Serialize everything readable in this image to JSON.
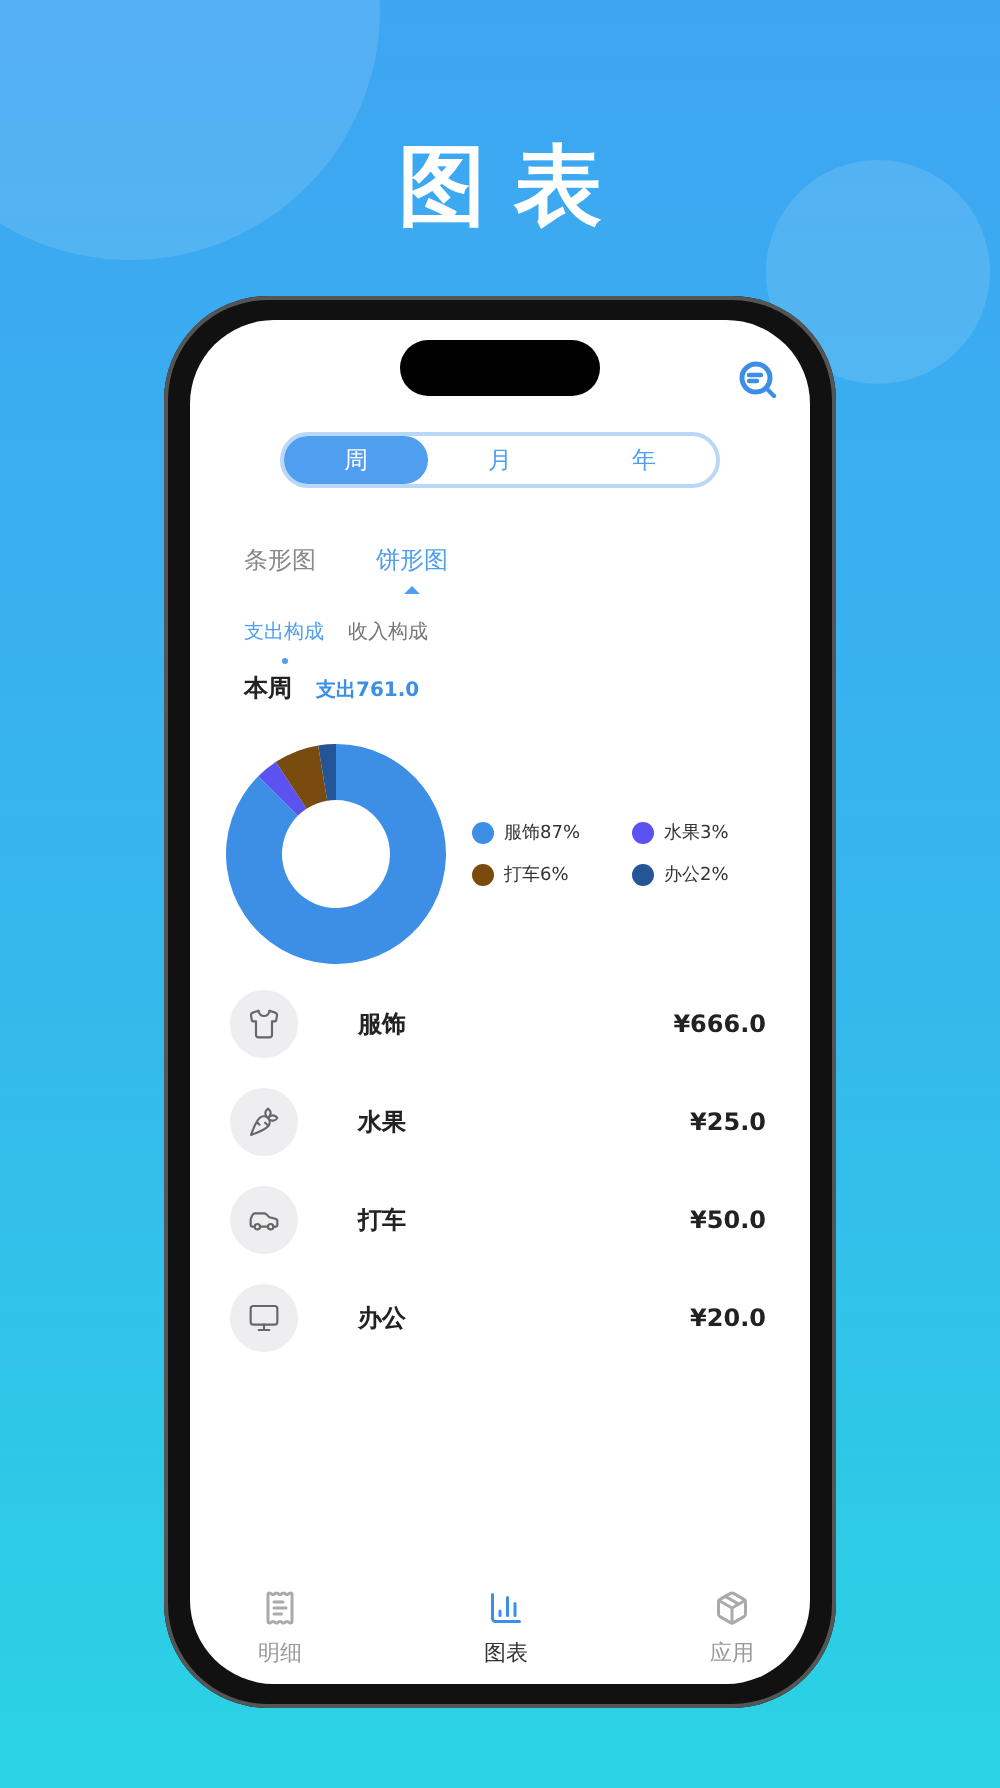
{
  "title": "图表",
  "period_tabs": [
    {
      "label": "周",
      "selected": true
    },
    {
      "label": "月",
      "selected": false
    },
    {
      "label": "年",
      "selected": false
    }
  ],
  "chart_tabs": [
    {
      "label": "条形图",
      "selected": false
    },
    {
      "label": "饼形图",
      "selected": true
    }
  ],
  "breakdown_tabs": [
    {
      "label": "支出构成",
      "selected": true
    },
    {
      "label": "收入构成",
      "selected": false
    }
  ],
  "summary": {
    "period": "本周",
    "total": "支出761.0"
  },
  "chart_data": {
    "type": "donut",
    "categories": [
      "服饰",
      "水果",
      "打车",
      "办公"
    ],
    "values": [
      87.5,
      3.3,
      6.6,
      2.6
    ],
    "legend": "right"
  },
  "legend": [
    {
      "share": "87%",
      "color": "#3d8fe6"
    },
    {
      "share": "3%",
      "color": "#5b52f0"
    },
    {
      "share": "6%",
      "color": "#7a4b0e"
    },
    {
      "share": "2%",
      "color": "#245596"
    }
  ],
  "categories": [
    {
      "name": "服饰",
      "amount": "¥666.0",
      "kind": "clothing"
    },
    {
      "name": "水果",
      "amount": "¥25.0",
      "kind": "fruit"
    },
    {
      "name": "打车",
      "amount": "¥50.0",
      "kind": "car"
    },
    {
      "name": "办公",
      "amount": "¥20.0",
      "kind": "office"
    }
  ],
  "nav": [
    {
      "label": "明细",
      "selected": false,
      "kind": "ledger"
    },
    {
      "label": "图表",
      "selected": true,
      "kind": "chart"
    },
    {
      "label": "应用",
      "selected": false,
      "kind": "apps"
    }
  ]
}
